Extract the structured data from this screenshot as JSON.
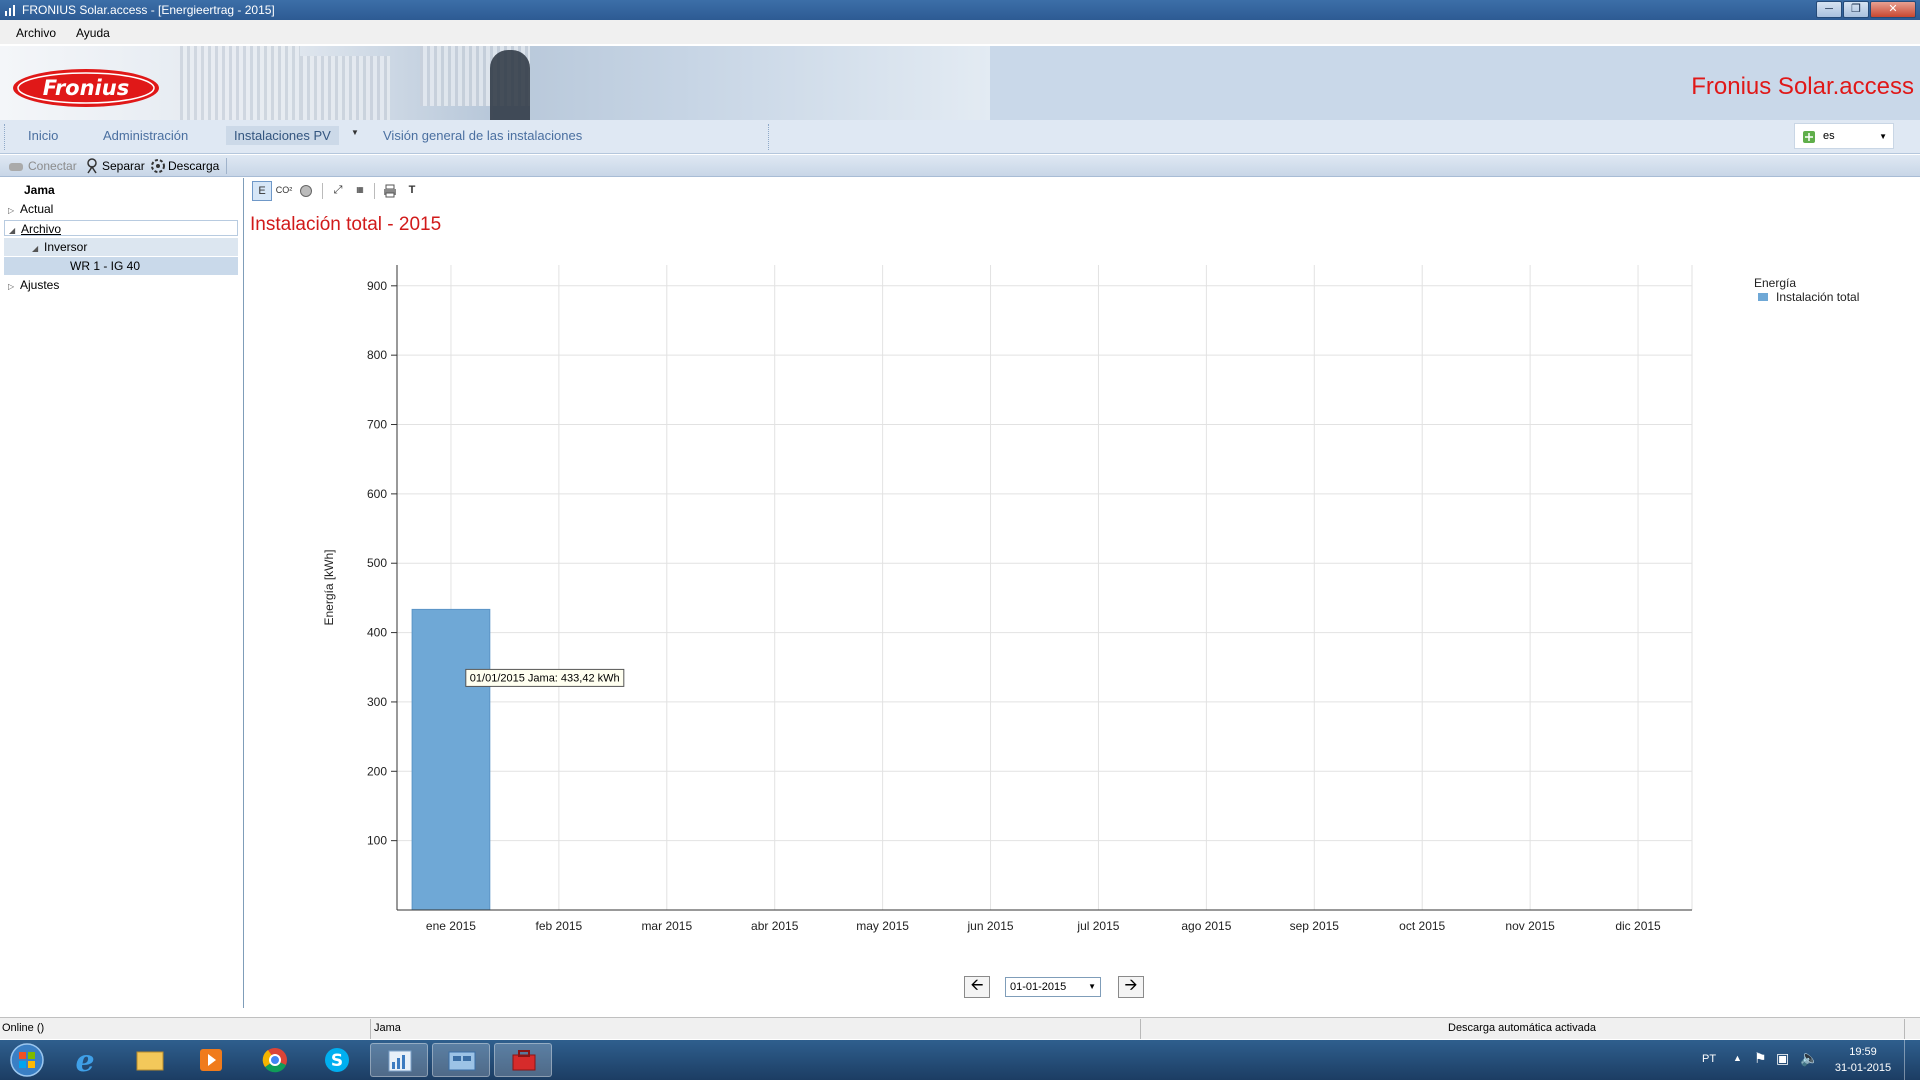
{
  "window": {
    "title": "FRONIUS Solar.access - [Energieertrag - 2015]"
  },
  "menu": {
    "items": [
      "Archivo",
      "Ayuda"
    ]
  },
  "banner": {
    "logo_text": "Fronius",
    "product_title": "Fronius Solar.access"
  },
  "nav": {
    "tabs": [
      "Inicio",
      "Administración",
      "Instalaciones PV",
      "Visión general de las instalaciones"
    ],
    "active_tab": "Instalaciones PV",
    "language": "es"
  },
  "toolbar": {
    "connect": "Conectar",
    "separate": "Separar",
    "download": "Descarga"
  },
  "tree": {
    "root": "Jama",
    "items": [
      "Actual",
      "Archivo",
      "Inversor",
      "WR 1 - IG 40",
      "Ajustes"
    ]
  },
  "chart_toolbar": {
    "energy_btn": "E",
    "co2_btn": "CO²",
    "text_btn": "T"
  },
  "chart_data": {
    "type": "bar",
    "title": "Instalación total - 2015",
    "ylabel": "Energía [kWh]",
    "xlabel": "",
    "categories": [
      "ene 2015",
      "feb 2015",
      "mar 2015",
      "abr 2015",
      "may 2015",
      "jun 2015",
      "jul 2015",
      "ago 2015",
      "sep 2015",
      "oct 2015",
      "nov 2015",
      "dic 2015"
    ],
    "series": [
      {
        "name": "Instalación total",
        "values": [
          433.42,
          0,
          0,
          0,
          0,
          0,
          0,
          0,
          0,
          0,
          0,
          0
        ]
      }
    ],
    "ylim": [
      0,
      930
    ],
    "yticks": [
      100,
      200,
      300,
      400,
      500,
      600,
      700,
      800,
      900
    ],
    "grid": true,
    "legend_title": "Energía",
    "legend_position": "top-right",
    "tooltip": "01/01/2015 Jama: 433,42 kWh",
    "bar_color": "#6fa8d6"
  },
  "date_nav": {
    "selected_date": "01-01-2015"
  },
  "status": {
    "left": "Online ()",
    "middle": "Jama",
    "right": "Descarga automática activada"
  },
  "taskbar": {
    "tray_lang": "PT",
    "time": "19:59",
    "date": "31-01-2015"
  }
}
